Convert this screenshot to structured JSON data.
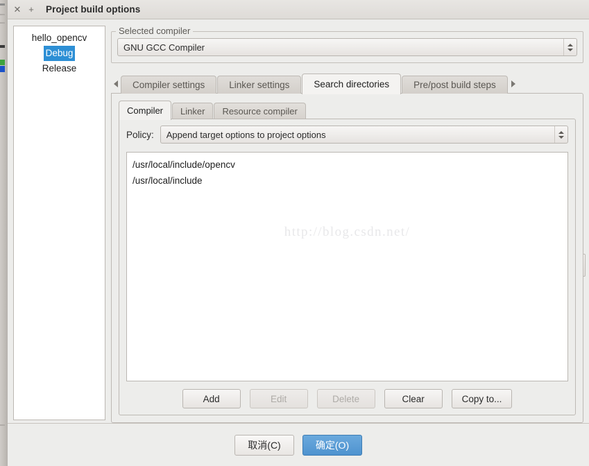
{
  "titlebar": {
    "close_icon": "close-icon",
    "add_icon": "plus-icon",
    "title": "Project build options"
  },
  "tree": {
    "items": [
      {
        "label": "hello_opencv",
        "selected": false
      },
      {
        "label": "Debug",
        "selected": true
      },
      {
        "label": "Release",
        "selected": false
      }
    ]
  },
  "compiler_group": {
    "label": "Selected compiler",
    "selected": "GNU GCC Compiler"
  },
  "outer_tabs": {
    "scroll_left_icon": "arrow-left-icon",
    "scroll_right_icon": "arrow-right-icon",
    "items": [
      {
        "label": "Compiler settings",
        "active": false
      },
      {
        "label": "Linker settings",
        "active": false
      },
      {
        "label": "Search directories",
        "active": true
      },
      {
        "label": "Pre/post build steps",
        "active": false
      }
    ]
  },
  "inner_tabs": {
    "items": [
      {
        "label": "Compiler",
        "active": true
      },
      {
        "label": "Linker",
        "active": false
      },
      {
        "label": "Resource compiler",
        "active": false
      }
    ]
  },
  "policy": {
    "label": "Policy:",
    "selected": "Append target options to project options"
  },
  "directories": {
    "items": [
      "/usr/local/include/opencv",
      "/usr/local/include"
    ],
    "watermark": "http://blog.csdn.net/"
  },
  "action_buttons": [
    {
      "label": "Add",
      "disabled": false
    },
    {
      "label": "Edit",
      "disabled": true
    },
    {
      "label": "Delete",
      "disabled": true
    },
    {
      "label": "Clear",
      "disabled": false
    },
    {
      "label": "Copy to...",
      "disabled": false
    }
  ],
  "footer": {
    "cancel_label": "取消(C)",
    "ok_label": "确定(O)"
  },
  "colors": {
    "selection_blue": "#2d8fd5",
    "primary_button_blue": "#4f93cf",
    "window_bg": "#ededeb",
    "field_bg": "#ffffff"
  }
}
